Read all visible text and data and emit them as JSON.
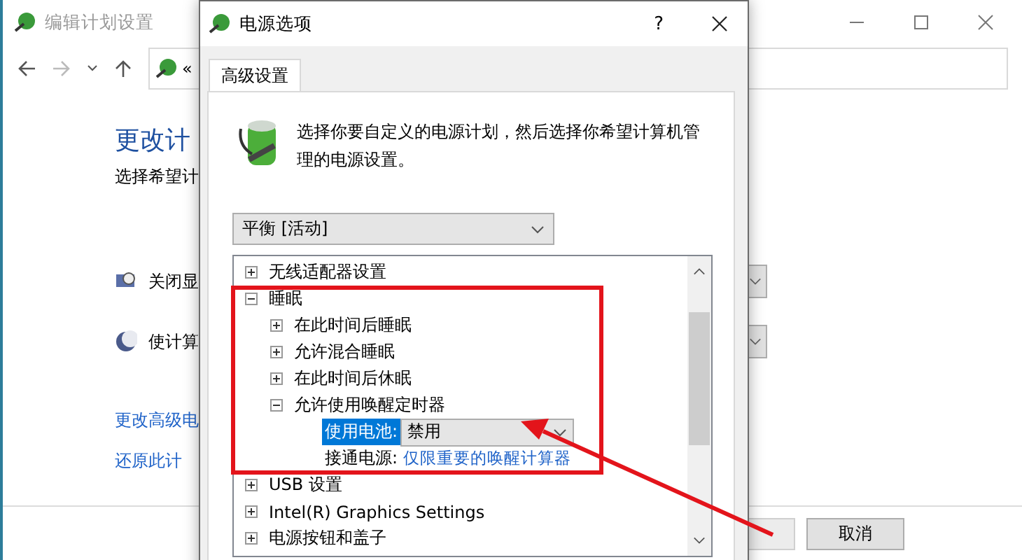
{
  "background_window": {
    "title": "编辑计划设置",
    "address_chevron": "«",
    "heading": "更改计",
    "subtitle": "选择希望计",
    "settings": [
      {
        "label": "关闭显",
        "kind": "display"
      },
      {
        "label": "使计算",
        "kind": "sleep"
      }
    ],
    "links": [
      "更改高级电",
      "还原此计"
    ],
    "buttons": [
      {
        "disabled": true
      },
      {
        "label": "取消",
        "disabled": false
      }
    ]
  },
  "dialog": {
    "title": "电源选项",
    "help": "?",
    "tabs": [
      {
        "label": "高级设置",
        "selected": true
      }
    ],
    "description": "选择你要自定义的电源计划，然后选择你希望计算机管理的电源设置。",
    "plan": "平衡 [活动]",
    "tree": [
      {
        "kind": "group",
        "label": "无线适配器设置",
        "expanded": false
      },
      {
        "kind": "group",
        "label": "睡眠",
        "expanded": true,
        "children": [
          {
            "kind": "group",
            "label": "在此时间后睡眠",
            "expanded": false
          },
          {
            "kind": "group",
            "label": "允许混合睡眠",
            "expanded": false
          },
          {
            "kind": "group",
            "label": "在此时间后休眠",
            "expanded": false
          },
          {
            "kind": "group",
            "label": "允许使用唤醒定时器",
            "expanded": true,
            "children": [
              {
                "kind": "dropdown",
                "label": "使用电池:",
                "value": "禁用",
                "selected": true
              },
              {
                "kind": "link",
                "label": "接通电源:",
                "value": "仅限重要的唤醒计算器",
                "selected": false
              }
            ]
          }
        ]
      },
      {
        "kind": "group",
        "label": "USB 设置",
        "expanded": false
      },
      {
        "kind": "group",
        "label": "Intel(R) Graphics Settings",
        "expanded": false
      },
      {
        "kind": "group",
        "label": "电源按钮和盖子",
        "expanded": false
      }
    ]
  }
}
